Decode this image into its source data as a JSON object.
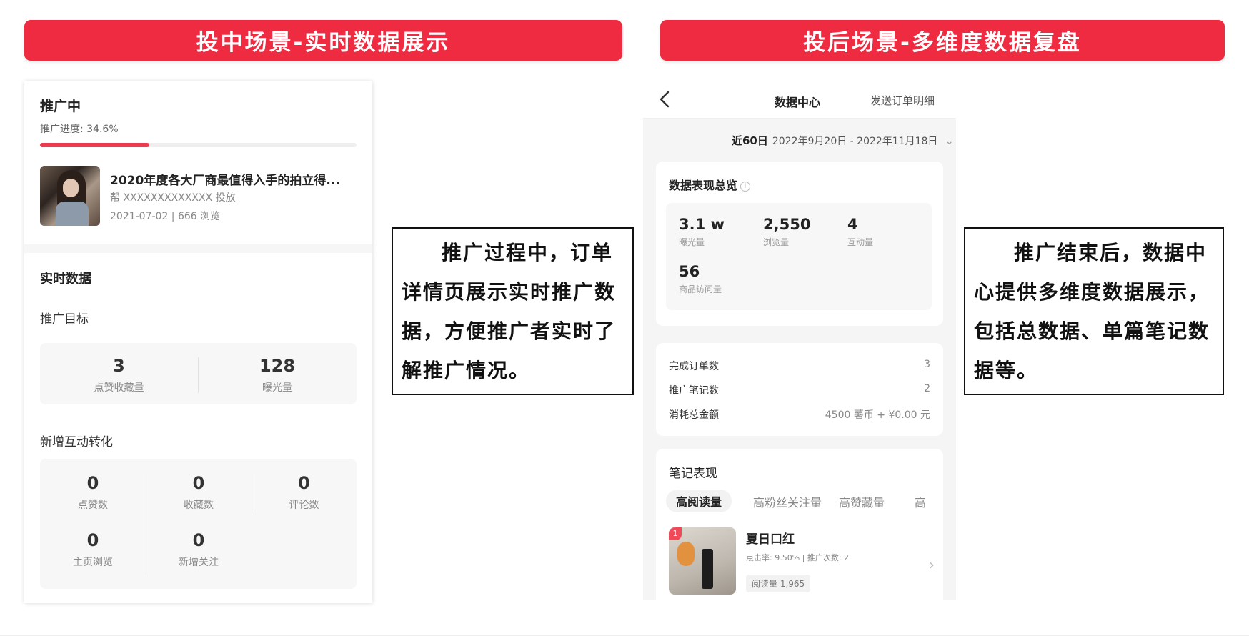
{
  "banners": {
    "left": "投中场景-实时数据展示",
    "right": "投后场景-多维度数据复盘",
    "color": "#ee2b40"
  },
  "left_card": {
    "status": "推广中",
    "progress_label": "推广进度: 34.6%",
    "progress_fraction": 0.346,
    "note": {
      "title": "2020年度各大厂商最值得入手的拍立得...",
      "by": "帮 XXXXXXXXXXXXX 投放",
      "meta": "2021-07-02 | 666 浏览"
    },
    "realtime_title": "实时数据",
    "goal_title": "推广目标",
    "goal_stats": [
      {
        "value": "3",
        "label": "点赞收藏量"
      },
      {
        "value": "128",
        "label": "曝光量"
      }
    ],
    "interaction_title": "新增互动转化",
    "interaction_stats": [
      {
        "value": "0",
        "label": "点赞数"
      },
      {
        "value": "0",
        "label": "收藏数"
      },
      {
        "value": "0",
        "label": "评论数"
      },
      {
        "value": "0",
        "label": "主页浏览"
      },
      {
        "value": "0",
        "label": "新增关注"
      }
    ]
  },
  "callouts": {
    "left": "推广过程中，订单详情页展示实时推广数据，方便推广者实时了解推广情况。",
    "right": "推广结束后，数据中心提供多维度数据展示，包括总数据、单篇笔记数据等。"
  },
  "right_phone": {
    "nav_title": "数据中心",
    "nav_action": "发送订单明细",
    "date_range_label": "近60日",
    "date_range": "2022年9月20日 - 2022年11月18日",
    "overview_title": "数据表现总览",
    "overview_stats": [
      {
        "value": "3.1 w",
        "label": "曝光量"
      },
      {
        "value": "2,550",
        "label": "浏览量"
      },
      {
        "value": "4",
        "label": "互动量"
      },
      {
        "value": "56",
        "label": "商品访问量"
      }
    ],
    "summary_rows": [
      {
        "label": "完成订单数",
        "value": "3"
      },
      {
        "label": "推广笔记数",
        "value": "2"
      },
      {
        "label": "消耗总金额",
        "value": "4500 薯币 + ¥0.00 元"
      }
    ],
    "notes_title": "笔记表现",
    "tabs": [
      "高阅读量",
      "高粉丝关注量",
      "高赞藏量",
      "高"
    ],
    "note": {
      "rank": "1",
      "name": "夏日口红",
      "stats": "点击率: 9.50% | 推广次数: 2",
      "read_tag": "阅读量 1,965"
    }
  }
}
